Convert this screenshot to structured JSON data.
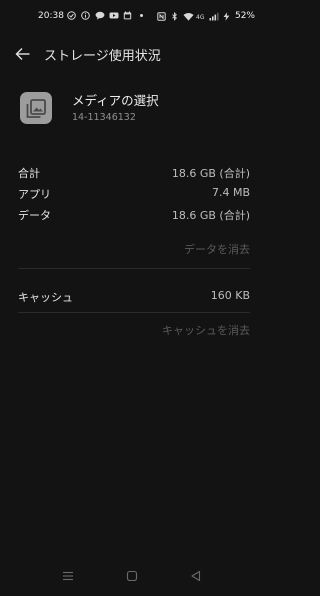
{
  "status_bar": {
    "time": "20:38",
    "battery": "52%",
    "left_icons": [
      "check-circle-icon",
      "info-circle-icon",
      "message-icon",
      "video-icon",
      "calendar-icon",
      "dot-icon"
    ],
    "right_icons": [
      "nfc-icon",
      "bluetooth-icon",
      "wifi-icon",
      "volte-icon",
      "signal-icon",
      "charging-icon"
    ]
  },
  "app_bar": {
    "title": "ストレージ使用状況",
    "back_icon": "arrow-left-icon"
  },
  "app": {
    "name": "メディアの選択",
    "version": "14-11346132",
    "icon": "photo-library-icon",
    "icon_color": "#9c9c9c"
  },
  "storage": {
    "total": {
      "label": "合計",
      "value": "18.6 GB (合計)"
    },
    "app": {
      "label": "アプリ",
      "value": "7.4 MB"
    },
    "data": {
      "label": "データ",
      "value": "18.6 GB (合計)"
    },
    "clear_data_label": "データを消去",
    "cache": {
      "label": "キャッシュ",
      "value": "160 KB"
    },
    "clear_cache_label": "キャッシュを消去"
  },
  "nav_bar": {
    "icons": [
      "menu-icon",
      "home-icon",
      "back-triangle-icon"
    ]
  },
  "colors": {
    "background": "#131313",
    "text_primary": "#e4e4e4",
    "text_secondary": "#bdbdbd",
    "text_disabled": "#5a5a5a"
  }
}
